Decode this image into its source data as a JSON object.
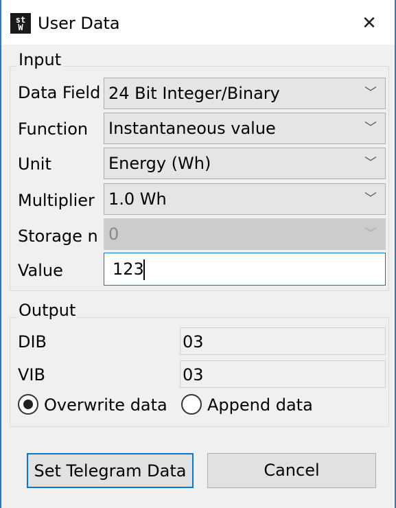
{
  "window": {
    "title": "User Data",
    "icon_text_top": "st",
    "icon_text_bottom": "W",
    "close_glyph": "✕"
  },
  "input": {
    "group_title": "Input",
    "data_field": {
      "label": "Data Field",
      "value": "24 Bit Integer/Binary"
    },
    "function": {
      "label": "Function",
      "value": "Instantaneous value"
    },
    "unit": {
      "label": "Unit",
      "value": "Energy (Wh)"
    },
    "multiplier": {
      "label": "Multiplier",
      "value": "1.0 Wh"
    },
    "storage": {
      "label": "Storage n",
      "value": "0"
    },
    "value": {
      "label": "Value",
      "value": "123"
    },
    "chevron": "﹀"
  },
  "output": {
    "group_title": "Output",
    "dib": {
      "label": "DIB",
      "value": "03"
    },
    "vib": {
      "label": "VIB",
      "value": "03"
    },
    "overwrite_label": "Overwrite data",
    "append_label": "Append data",
    "selected_mode": "overwrite"
  },
  "buttons": {
    "set": "Set Telegram Data",
    "cancel": "Cancel"
  },
  "colors": {
    "accent": "#0078d7",
    "window_border": "#2b78c5"
  }
}
